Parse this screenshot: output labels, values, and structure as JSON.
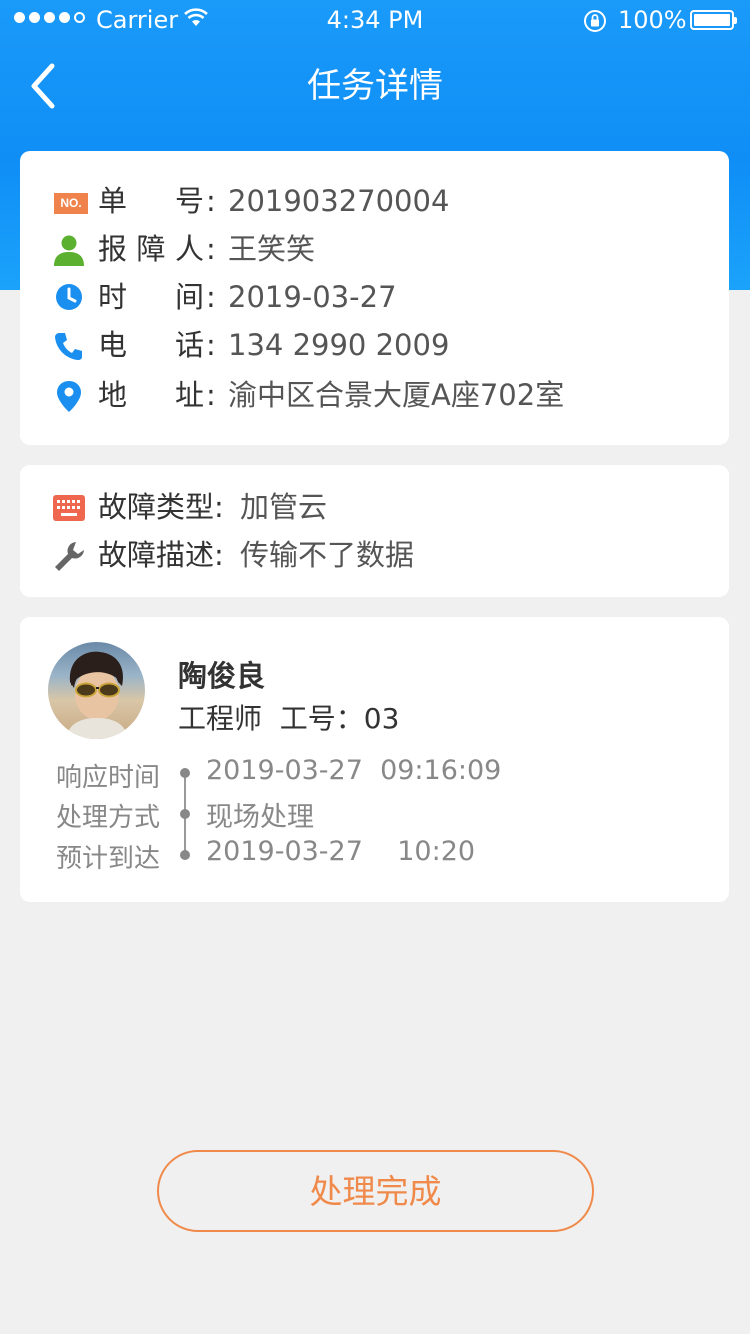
{
  "status_bar": {
    "carrier": "Carrier",
    "time": "4:34 PM",
    "battery": "100%"
  },
  "nav": {
    "title": "任务详情"
  },
  "order": {
    "no_badge": "NO.",
    "number_label": "单号",
    "number_value": "201903270004",
    "reporter_label": "报障人",
    "reporter_value": "王笑笑",
    "time_label": "时间",
    "time_value": "2019-03-27",
    "phone_label": "电话",
    "phone_value": "134 2990 2009",
    "address_label": "地址",
    "address_value": "渝中区合景大厦A座702室",
    "colon": ":"
  },
  "fault": {
    "type_label": "故障类型:",
    "type_value": "加管云",
    "desc_label": "故障描述:",
    "desc_value": "传输不了数据"
  },
  "engineer": {
    "name": "陶俊良",
    "role": "工程师  工号：03",
    "timeline": [
      {
        "label": "响应时间",
        "value": "2019-03-27  09:16:09"
      },
      {
        "label": "处理方式",
        "value": "现场处理"
      },
      {
        "label": "预计到达",
        "value": "2019-03-27    10:20"
      }
    ]
  },
  "actions": {
    "complete_label": "处理完成"
  },
  "colors": {
    "header_blue": "#1a9af9",
    "accent_orange": "#f08a4b",
    "icon_green": "#5bb12f",
    "icon_blue": "#1a8ff0",
    "icon_red": "#f0674f"
  }
}
